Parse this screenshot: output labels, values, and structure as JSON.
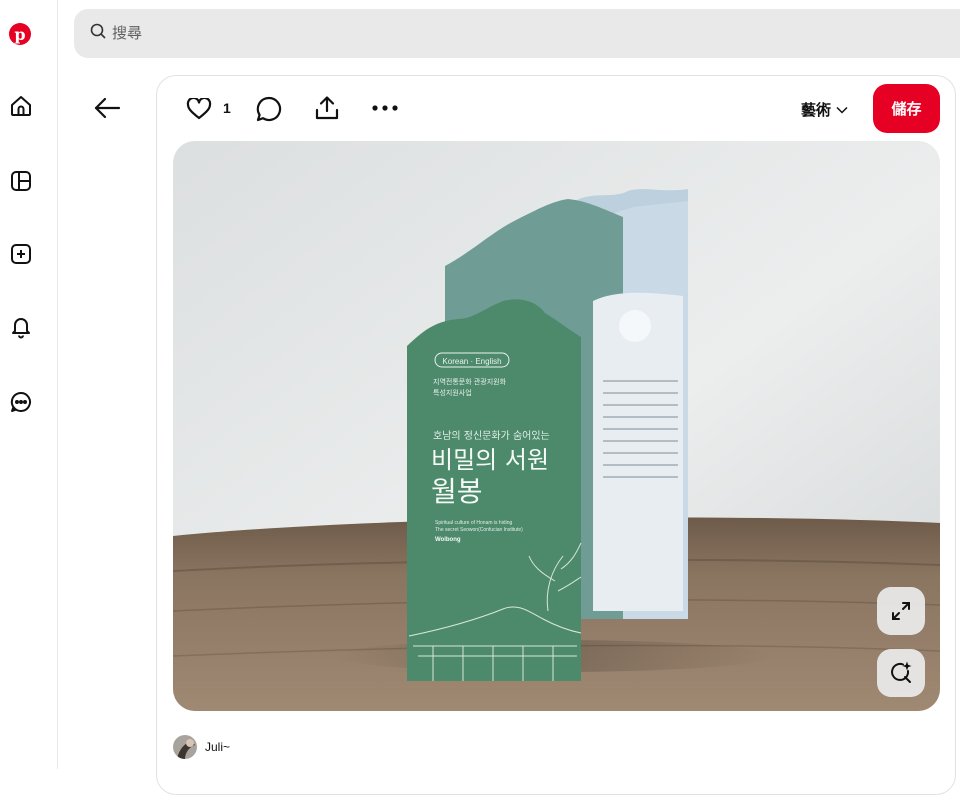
{
  "brand": {
    "logo_letter": "p",
    "color": "#e60023"
  },
  "sidebar": {
    "items": [
      {
        "name": "home",
        "icon": "home-icon"
      },
      {
        "name": "boards",
        "icon": "boards-icon"
      },
      {
        "name": "create",
        "icon": "plus-square-icon"
      },
      {
        "name": "notifications",
        "icon": "bell-icon"
      },
      {
        "name": "messages",
        "icon": "chat-icon"
      }
    ]
  },
  "search": {
    "placeholder": "搜尋",
    "value": ""
  },
  "pin": {
    "like_count": "1",
    "board_label": "藝術",
    "save_label": "儲存",
    "author": "Juli~",
    "image": {
      "description_texts": {
        "pill": "Korean · English",
        "line1": "지역전통문화 관광지원화",
        "line2": "특성지원사업",
        "sub": "호남의 정신문화가 숨어있는",
        "title1": "비밀의 서원",
        "title2": "월봉",
        "en1": "Spiritual culture of Honam is hiding",
        "en2": "The secret Seowon(Confucian Institute)",
        "en3": "Wolbong"
      }
    }
  }
}
